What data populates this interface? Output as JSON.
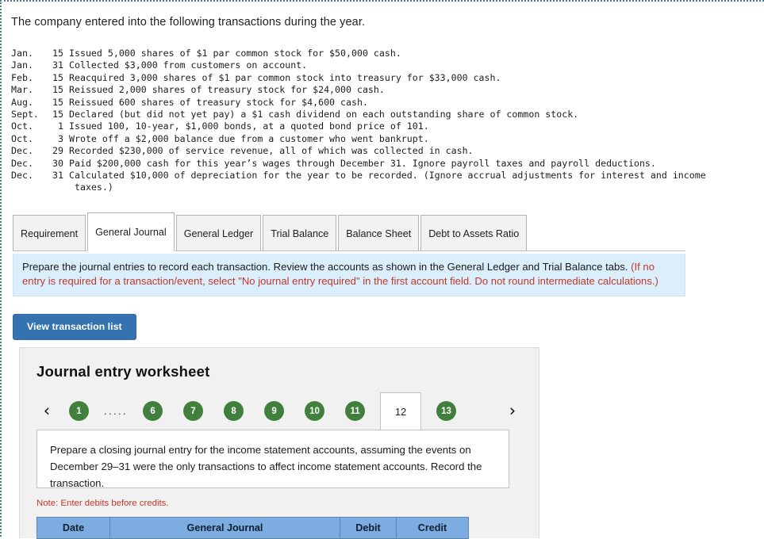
{
  "intro": "The company entered into the following transactions during the year.",
  "transactions": [
    {
      "month": "Jan.",
      "day": "15",
      "desc": "Issued 5,000 shares of $1 par common stock for $50,000 cash."
    },
    {
      "month": "Jan.",
      "day": "31",
      "desc": "Collected $3,000 from customers on account."
    },
    {
      "month": "Feb.",
      "day": "15",
      "desc": "Reacquired 3,000 shares of $1 par common stock into treasury for $33,000 cash."
    },
    {
      "month": "Mar.",
      "day": "15",
      "desc": "Reissued 2,000 shares of treasury stock for $24,000 cash."
    },
    {
      "month": "Aug.",
      "day": "15",
      "desc": "Reissued 600 shares of treasury stock for $4,600 cash."
    },
    {
      "month": "Sept.",
      "day": "15",
      "desc": "Declared (but did not yet pay) a $1 cash dividend on each outstanding share of common stock."
    },
    {
      "month": "Oct.",
      "day": "1",
      "desc": "Issued 100, 10-year, $1,000 bonds, at a quoted bond price of 101."
    },
    {
      "month": "Oct.",
      "day": "3",
      "desc": "Wrote off a $2,000 balance due from a customer who went bankrupt."
    },
    {
      "month": "Dec.",
      "day": "29",
      "desc": "Recorded $230,000 of service revenue, all of which was collected in cash."
    },
    {
      "month": "Dec.",
      "day": "30",
      "desc": "Paid $200,000 cash for this year’s wages through December 31. Ignore payroll taxes and payroll deductions."
    },
    {
      "month": "Dec.",
      "day": "31",
      "desc": "Calculated $10,000 of depreciation for the year to be recorded. (Ignore accrual adjustments for interest and income",
      "cont": "taxes.)"
    }
  ],
  "tabs": [
    {
      "label": "Requirement",
      "active": false
    },
    {
      "label": "General Journal",
      "active": true
    },
    {
      "label": "General Ledger",
      "active": false
    },
    {
      "label": "Trial Balance",
      "active": false
    },
    {
      "label": "Balance Sheet",
      "active": false
    },
    {
      "label": "Debt to Assets Ratio",
      "active": false
    }
  ],
  "instruction": {
    "black_part": "Prepare the journal entries to record each transaction. Review the accounts as shown in the General Ledger and Trial Balance tabs. ",
    "red_part": "(If no entry is required for a transaction/event, select \"No journal entry required\" in the first account field. Do not round intermediate calculations.)"
  },
  "buttons": {
    "view_transaction_list": "View transaction list"
  },
  "worksheet": {
    "title": "Journal entry worksheet",
    "pager": {
      "prev_icon": "‹",
      "next_icon": "›",
      "ellipsis": ".....",
      "pages_before": [
        "1"
      ],
      "pages_mid": [
        "6",
        "7",
        "8",
        "9",
        "10",
        "11"
      ],
      "active_page": "12",
      "pages_after": [
        "13"
      ]
    },
    "question": "Prepare a closing journal entry for the income statement accounts, assuming the events on December 29–31 were the only transactions to affect income statement accounts. Record the transaction.",
    "note": "Note: Enter debits before credits.",
    "table_headers": [
      "Date",
      "General Journal",
      "Debit",
      "Credit"
    ]
  },
  "colors": {
    "accent_blue": "#3572b0",
    "banner_blue": "#daeefb",
    "table_header_blue": "#7cace0",
    "pager_green": "#41803c",
    "red_text": "#c0392b",
    "dotted_border": "#4d7890"
  }
}
